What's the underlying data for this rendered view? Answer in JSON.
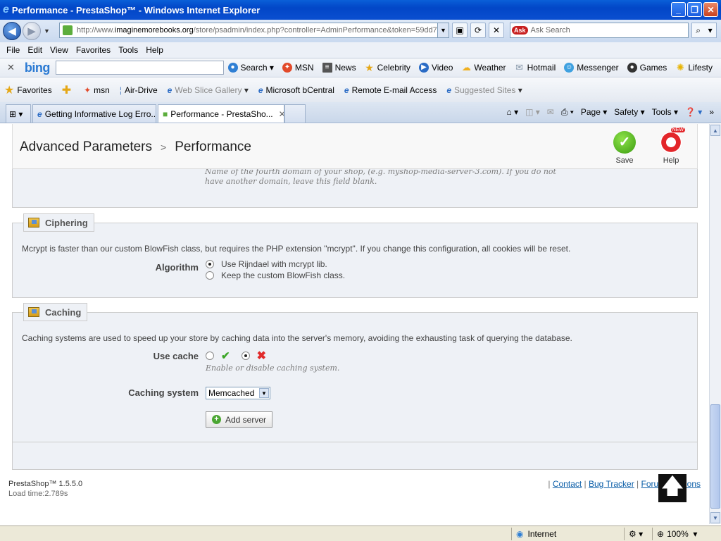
{
  "window": {
    "title": "Performance - PrestaShop™ - Windows Internet Explorer"
  },
  "address": {
    "prefix": "http://www.",
    "domain": "imaginemorebooks.org",
    "path": "/store/psadmin/index.php?controller=AdminPerformance&token=59dd7"
  },
  "search": {
    "placeholder": "Ask Search",
    "badge": "Ask"
  },
  "menu": [
    "File",
    "Edit",
    "View",
    "Favorites",
    "Tools",
    "Help"
  ],
  "bing": {
    "logo": "bing",
    "items": [
      {
        "label": "Search",
        "icon": "globe-icon",
        "color": "#2f7fd4"
      },
      {
        "label": "MSN",
        "icon": "msn-butterfly-icon",
        "color": "#e24a2a"
      },
      {
        "label": "News",
        "icon": "news-icon",
        "color": "#555555"
      },
      {
        "label": "Celebrity",
        "icon": "star-icon",
        "color": "#e5a715"
      },
      {
        "label": "Video",
        "icon": "play-icon",
        "color": "#2a6bc5"
      },
      {
        "label": "Weather",
        "icon": "cloud-icon",
        "color": "#f0b020"
      },
      {
        "label": "Hotmail",
        "icon": "mail-icon",
        "color": "#8899aa"
      },
      {
        "label": "Messenger",
        "icon": "messenger-icon",
        "color": "#3fa1e0"
      },
      {
        "label": "Games",
        "icon": "games-icon",
        "color": "#333333"
      },
      {
        "label": "Lifesty",
        "icon": "bulb-icon",
        "color": "#e8b400"
      }
    ]
  },
  "favorites": {
    "label": "Favorites",
    "items": [
      {
        "label": "msn"
      },
      {
        "label": "Air-Drive"
      },
      {
        "label": "Web Slice Gallery",
        "dim": true
      },
      {
        "label": "Microsoft bCentral"
      },
      {
        "label": "Remote E-mail Access"
      },
      {
        "label": "Suggested Sites",
        "dim": true
      }
    ]
  },
  "tabs": [
    {
      "label": "Getting Informative Log Erro..."
    },
    {
      "label": "Performance - PrestaSho...",
      "active": true
    }
  ],
  "commandbar": [
    "Page",
    "Safety",
    "Tools"
  ],
  "page": {
    "breadcrumb_parent": "Advanced Parameters",
    "breadcrumb_current": "Performance",
    "save_label": "Save",
    "help_label": "Help",
    "help_badge": "NEW",
    "domain_hint_line1": "Name of the fourth domain of your shop, (e.g. myshop-media-server-3.com). If you do not",
    "domain_hint_line2": "have another domain, leave this field blank.",
    "ciphering": {
      "legend": "Ciphering",
      "desc": "Mcrypt is faster than our custom BlowFish class, but requires the PHP extension \"mcrypt\". If you change this configuration, all cookies will be reset.",
      "algorithm_label": "Algorithm",
      "option_rijndael": "Use Rijndael with mcrypt lib.",
      "option_blowfish": "Keep the custom BlowFish class.",
      "selected": "rijndael"
    },
    "caching": {
      "legend": "Caching",
      "desc": "Caching systems are used to speed up your store by caching data into the server's memory, avoiding the exhausting task of querying the database.",
      "use_cache_label": "Use cache",
      "use_cache_value": "no",
      "use_cache_hint": "Enable or disable caching system.",
      "system_label": "Caching system",
      "system_value": "Memcached",
      "add_server": "Add server"
    },
    "footer": {
      "version": "PrestaShop™ 1.5.5.0",
      "loadtime": "Load time:2.789s",
      "links": [
        "Contact",
        "Bug Tracker",
        "Forum",
        "Addons"
      ]
    }
  },
  "status": {
    "zone": "Internet",
    "zoom": "100%"
  }
}
